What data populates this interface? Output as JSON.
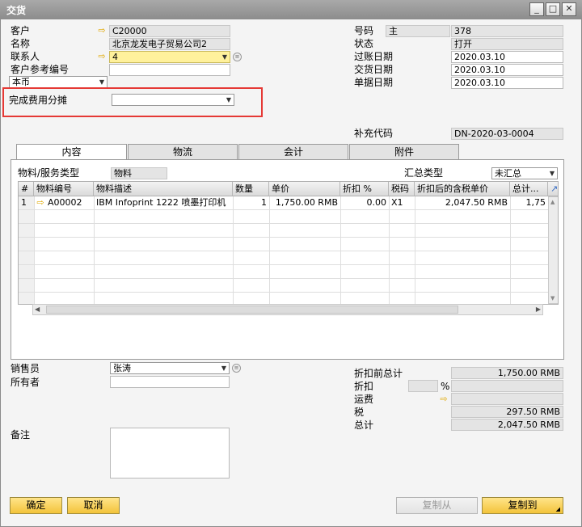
{
  "window": {
    "title": "交货"
  },
  "header_left": {
    "customer": {
      "label": "客户",
      "value": "C20000"
    },
    "name": {
      "label": "名称",
      "value": "北京龙发电子贸易公司2"
    },
    "contact": {
      "label": "联系人",
      "value": "4"
    },
    "customer_ref": {
      "label": "客户参考编号",
      "value": ""
    },
    "currency": {
      "label": "本币",
      "value": ""
    },
    "cost_allocation": {
      "label": "完成费用分摊",
      "value": ""
    }
  },
  "header_right": {
    "number": {
      "label": "号码",
      "series": "主",
      "value": "378"
    },
    "status": {
      "label": "状态",
      "value": "打开"
    },
    "posting_date": {
      "label": "过账日期",
      "value": "2020.03.10"
    },
    "delivery_date": {
      "label": "交货日期",
      "value": "2020.03.10"
    },
    "document_date": {
      "label": "单据日期",
      "value": "2020.03.10"
    },
    "supplementary_code": {
      "label": "补充代码",
      "value": "DN-2020-03-0004"
    }
  },
  "tabs": [
    {
      "label": "内容"
    },
    {
      "label": "物流"
    },
    {
      "label": "会计"
    },
    {
      "label": "附件"
    }
  ],
  "content": {
    "item_type_label": "物料/服务类型",
    "item_type_value": "物料",
    "summary_type_label": "汇总类型",
    "summary_type_value": "未汇总",
    "columns": [
      "#",
      "物料编号",
      "物料描述",
      "数量",
      "单价",
      "折扣 %",
      "税码",
      "折扣后的含税单价",
      "总计..."
    ],
    "rows": [
      {
        "num": "1",
        "item_no": "A00002",
        "desc": "IBM Infoprint 1222 喷墨打印机",
        "qty": "1",
        "price": "1,750.00 RMB",
        "discount": "0.00",
        "tax": "X1",
        "price_after": "2,047.50 RMB",
        "total": "1,75"
      }
    ]
  },
  "footer_left": {
    "sales_employee": {
      "label": "销售员",
      "value": "张涛"
    },
    "owner": {
      "label": "所有者",
      "value": ""
    },
    "remarks": {
      "label": "备注",
      "value": ""
    }
  },
  "footer_right": {
    "total_before_discount": {
      "label": "折扣前总计",
      "value": "1,750.00 RMB"
    },
    "discount": {
      "label": "折扣",
      "percent_sign": "%",
      "value": ""
    },
    "freight": {
      "label": "运费",
      "value": ""
    },
    "tax": {
      "label": "税",
      "value": "297.50 RMB"
    },
    "total": {
      "label": "总计",
      "value": "2,047.50 RMB"
    }
  },
  "buttons": {
    "ok": "确定",
    "cancel": "取消",
    "copy_from": "复制从",
    "copy_to": "复制到"
  },
  "icons": {
    "link_arrow": "right-arrow-icon",
    "expand": "expand-icon"
  },
  "colors": {
    "accent": "#f3c33a",
    "mandatory": "#fff19c",
    "highlight_box": "#e53935"
  }
}
